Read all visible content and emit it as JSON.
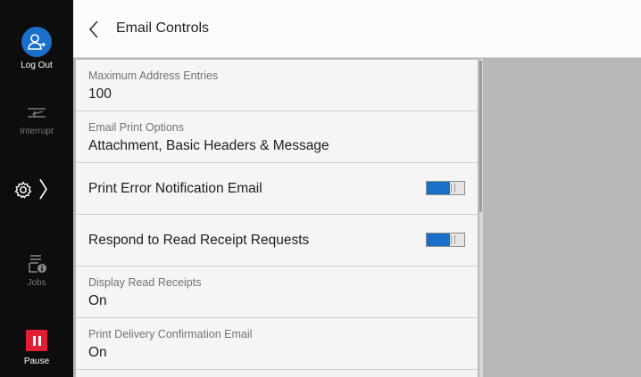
{
  "sidebar": {
    "logout_label": "Log Out",
    "interrupt_label": "Interrupt",
    "settings_chevron": "〉",
    "jobs_label": "Jobs",
    "pause_label": "Pause"
  },
  "header": {
    "title": "Email Controls"
  },
  "settings": [
    {
      "label": "Maximum Address Entries",
      "value": "100"
    },
    {
      "label": "Email Print Options",
      "value": "Attachment, Basic Headers & Message"
    }
  ],
  "toggles": [
    {
      "title": "Print Error Notification Email",
      "state": "on"
    },
    {
      "title": "Respond to Read Receipt Requests",
      "state": "on"
    }
  ],
  "settings2": [
    {
      "label": "Display Read Receipts",
      "value": "On"
    },
    {
      "label": "Print Delivery Confirmation Email",
      "value": "On"
    }
  ],
  "colors": {
    "accent": "#1b6fc9",
    "pause": "#e01d35",
    "sidebar": "#0d0d0d"
  }
}
